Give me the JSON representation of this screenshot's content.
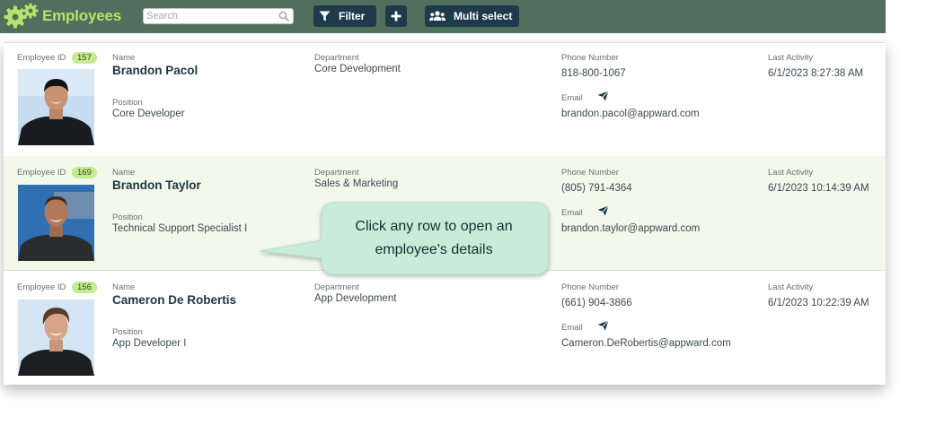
{
  "app": {
    "title": "Employees"
  },
  "search": {
    "placeholder": "Search",
    "value": ""
  },
  "toolbar": {
    "filter_label": "Filter",
    "add_label": "+",
    "multi_label": "Multi select"
  },
  "labels": {
    "employee_id": "Employee ID",
    "name": "Name",
    "position": "Position",
    "department": "Department",
    "phone": "Phone Number",
    "email": "Email",
    "last_activity": "Last Activity"
  },
  "employees": [
    {
      "id": "157",
      "name": "Brandon Pacol",
      "position": "Core Developer",
      "department": "Core Development",
      "phone": "818-800-1067",
      "email": "brandon.pacol@appward.com",
      "last_activity": "6/1/2023 8:27:38 AM"
    },
    {
      "id": "169",
      "name": "Brandon Taylor",
      "position": "Technical Support Specialist I",
      "department": "Sales & Marketing",
      "phone": "(805) 791-4364",
      "email": "brandon.taylor@appward.com",
      "last_activity": "6/1/2023 10:14:39 AM"
    },
    {
      "id": "156",
      "name": "Cameron De Robertis",
      "position": "App Developer I",
      "department": "App Development",
      "phone": "(661) 904-3866",
      "email": "Cameron.DeRobertis@appward.com",
      "last_activity": "6/1/2023 10:22:39 AM"
    }
  ],
  "tooltip": {
    "line1": "Click any row to open an",
    "line2": "employee's details"
  },
  "colors": {
    "header": "#506f5c",
    "brand": "#b6e36a",
    "button": "#1e3b4c",
    "badge": "#c5ea8f",
    "selected_row": "#f2f9eb",
    "tooltip": "#c8ecd8"
  },
  "icons": {
    "logo": "gears-icon",
    "search": "search-icon",
    "filter": "filter-icon",
    "add": "plus-icon",
    "multi": "users-icon",
    "email": "send-icon"
  }
}
